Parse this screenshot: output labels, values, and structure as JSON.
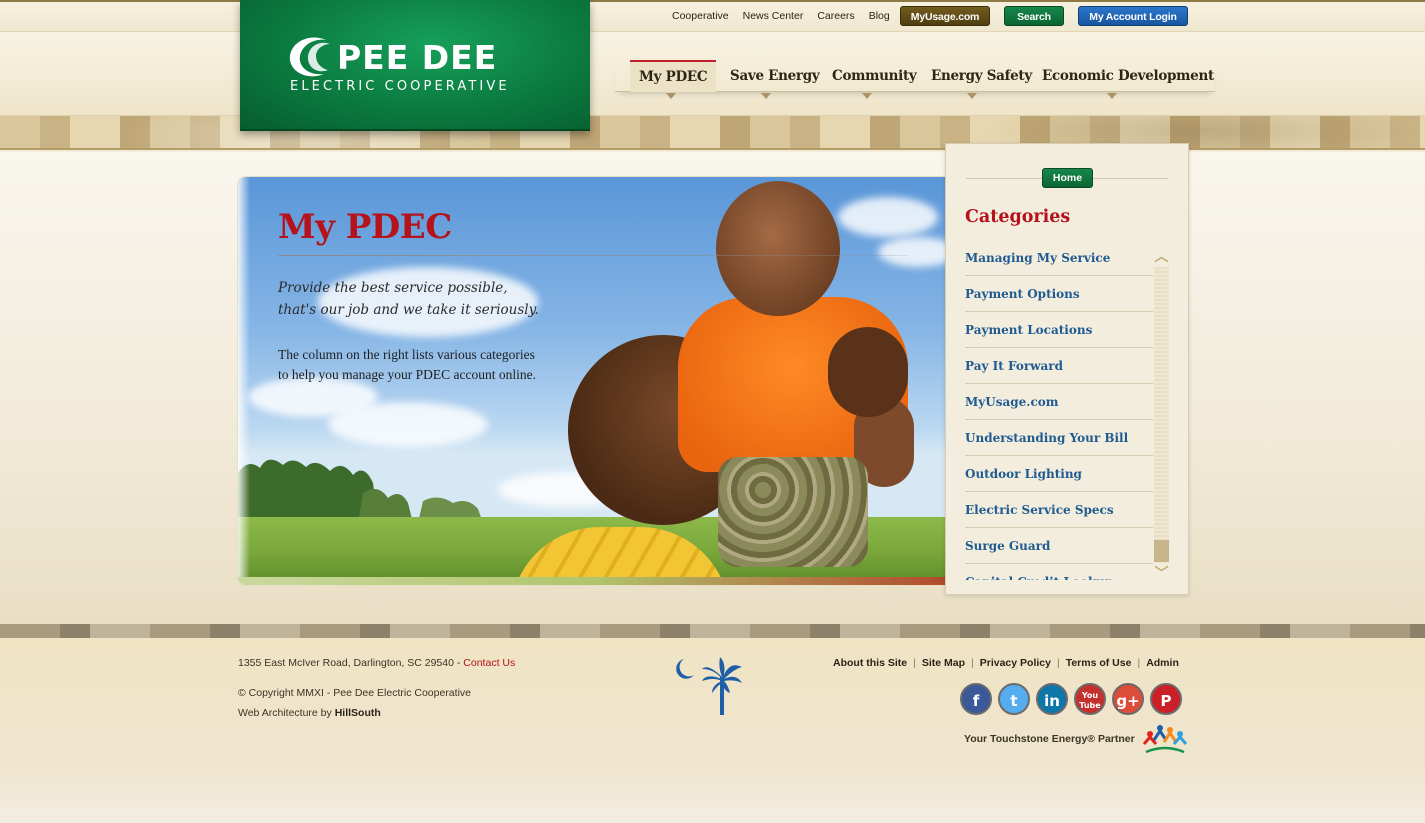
{
  "logo": {
    "name": "PEE DEE",
    "subtitle": "ELECTRIC COOPERATIVE"
  },
  "utility_links": [
    "Cooperative",
    "News Center",
    "Careers",
    "Blog"
  ],
  "utility_buttons": {
    "myusage": "MyUsage.com",
    "search": "Search",
    "login": "My Account Login"
  },
  "main_nav": [
    "My PDEC",
    "Save Energy",
    "Community",
    "Energy Safety",
    "Economic Development"
  ],
  "hero": {
    "title": "My PDEC",
    "tagline_line1": "Provide the best service possible,",
    "tagline_line2": "that's our job and we take it seriously.",
    "desc_line1": "The column on the right lists various categories",
    "desc_line2": "to help you manage your PDEC account online."
  },
  "sidebar": {
    "home": "Home",
    "title": "Categories",
    "items": [
      "Managing My Service",
      "Payment Options",
      "Payment Locations",
      "Pay It Forward",
      "MyUsage.com",
      "Understanding Your Bill",
      "Outdoor Lighting",
      "Electric Service Specs",
      "Surge Guard",
      "Capital Credit Lookup"
    ]
  },
  "footer": {
    "address": "1355 East McIver Road, Darlington, SC 29540 - ",
    "contact": "Contact Us",
    "copyright": "© Copyright MMXI - Pee Dee Electric Cooperative",
    "web_prefix": "Web Architecture by ",
    "web_company": "HillSouth",
    "links": [
      "About this Site",
      "Site Map",
      "Privacy Policy",
      "Terms of Use",
      "Admin"
    ],
    "separator": "|",
    "touchstone": "Your Touchstone Energy® Partner",
    "social": {
      "facebook": "f",
      "twitter": "t",
      "linkedin": "in",
      "youtube": "You Tube",
      "googleplus": "g+",
      "pinterest": "P"
    }
  },
  "colors": {
    "brand_green": "#0b7a3f",
    "accent_red": "#b5121b",
    "link_blue": "#1f5a91",
    "facebook": "#3b5998",
    "twitter": "#55acee",
    "linkedin": "#0e76a8",
    "youtube": "#c4302b",
    "googleplus": "#dd4b39",
    "pinterest": "#cb2027"
  }
}
